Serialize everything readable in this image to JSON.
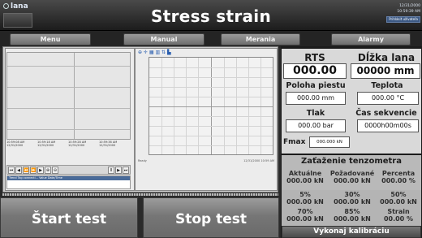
{
  "header": {
    "app_name": "lana",
    "title": "Stress strain",
    "date": "12/31/2000",
    "time": "10:59:39 AM",
    "login_label": "Prihlásiť užívateľa"
  },
  "nav": {
    "items": [
      {
        "label": "Menu"
      },
      {
        "label": "Manual"
      },
      {
        "label": "Merania"
      },
      {
        "label": "Alarmy"
      }
    ]
  },
  "trend": {
    "axis_times": [
      "10:59:08 AM\n12/31/2000",
      "10:59:18 AM\n12/31/2000",
      "10:59:28 AM\n12/31/2000",
      "10:59:38 AM\n12/31/2000"
    ],
    "table_header": "Trend    Tag connecti...    Value    Date/Time"
  },
  "xy": {
    "toolbar_icons": "⊕ ✛ ▦ ▥ ⇅ ▙",
    "status_left": "Ready",
    "status_right": "12/31/2000 10:59 AM"
  },
  "panel": {
    "rts_label": "RTS",
    "rts_value": "000.00",
    "dlzka_label": "Dĺžka lana",
    "dlzka_value": "00000 mm",
    "poloha_label": "Poloha piestu",
    "poloha_value": "000.00 mm",
    "teplota_label": "Teplota",
    "teplota_value": "000.00 °C",
    "tlak_label": "Tlak",
    "tlak_value": "000.00 bar",
    "cas_label": "Čas sekvencie",
    "cas_value": "0000h00m00s",
    "fmax_label": "Fmax",
    "fmax_value": "000.000 kN"
  },
  "tenzometer": {
    "title": "Zaťaženie tenzometra",
    "headers": [
      "Aktuálne",
      "Požadované",
      "Percenta"
    ],
    "values": [
      "000.00 kN",
      "000.00 kN",
      "000.00 %"
    ],
    "pct_row1": [
      {
        "label": "5%",
        "value": "000.00 kN"
      },
      {
        "label": "30%",
        "value": "000.00 kN"
      },
      {
        "label": "50%",
        "value": "000.00 kN"
      }
    ],
    "pct_row2": [
      {
        "label": "70%",
        "value": "000.00 kN"
      },
      {
        "label": "85%",
        "value": "000.00 kN"
      },
      {
        "label": "Strain",
        "value": "00.00 %"
      }
    ],
    "calibrate_label": "Vykonaj kalibráciu"
  },
  "actions": {
    "start_label": "Štart test",
    "stop_label": "Stop test"
  }
}
